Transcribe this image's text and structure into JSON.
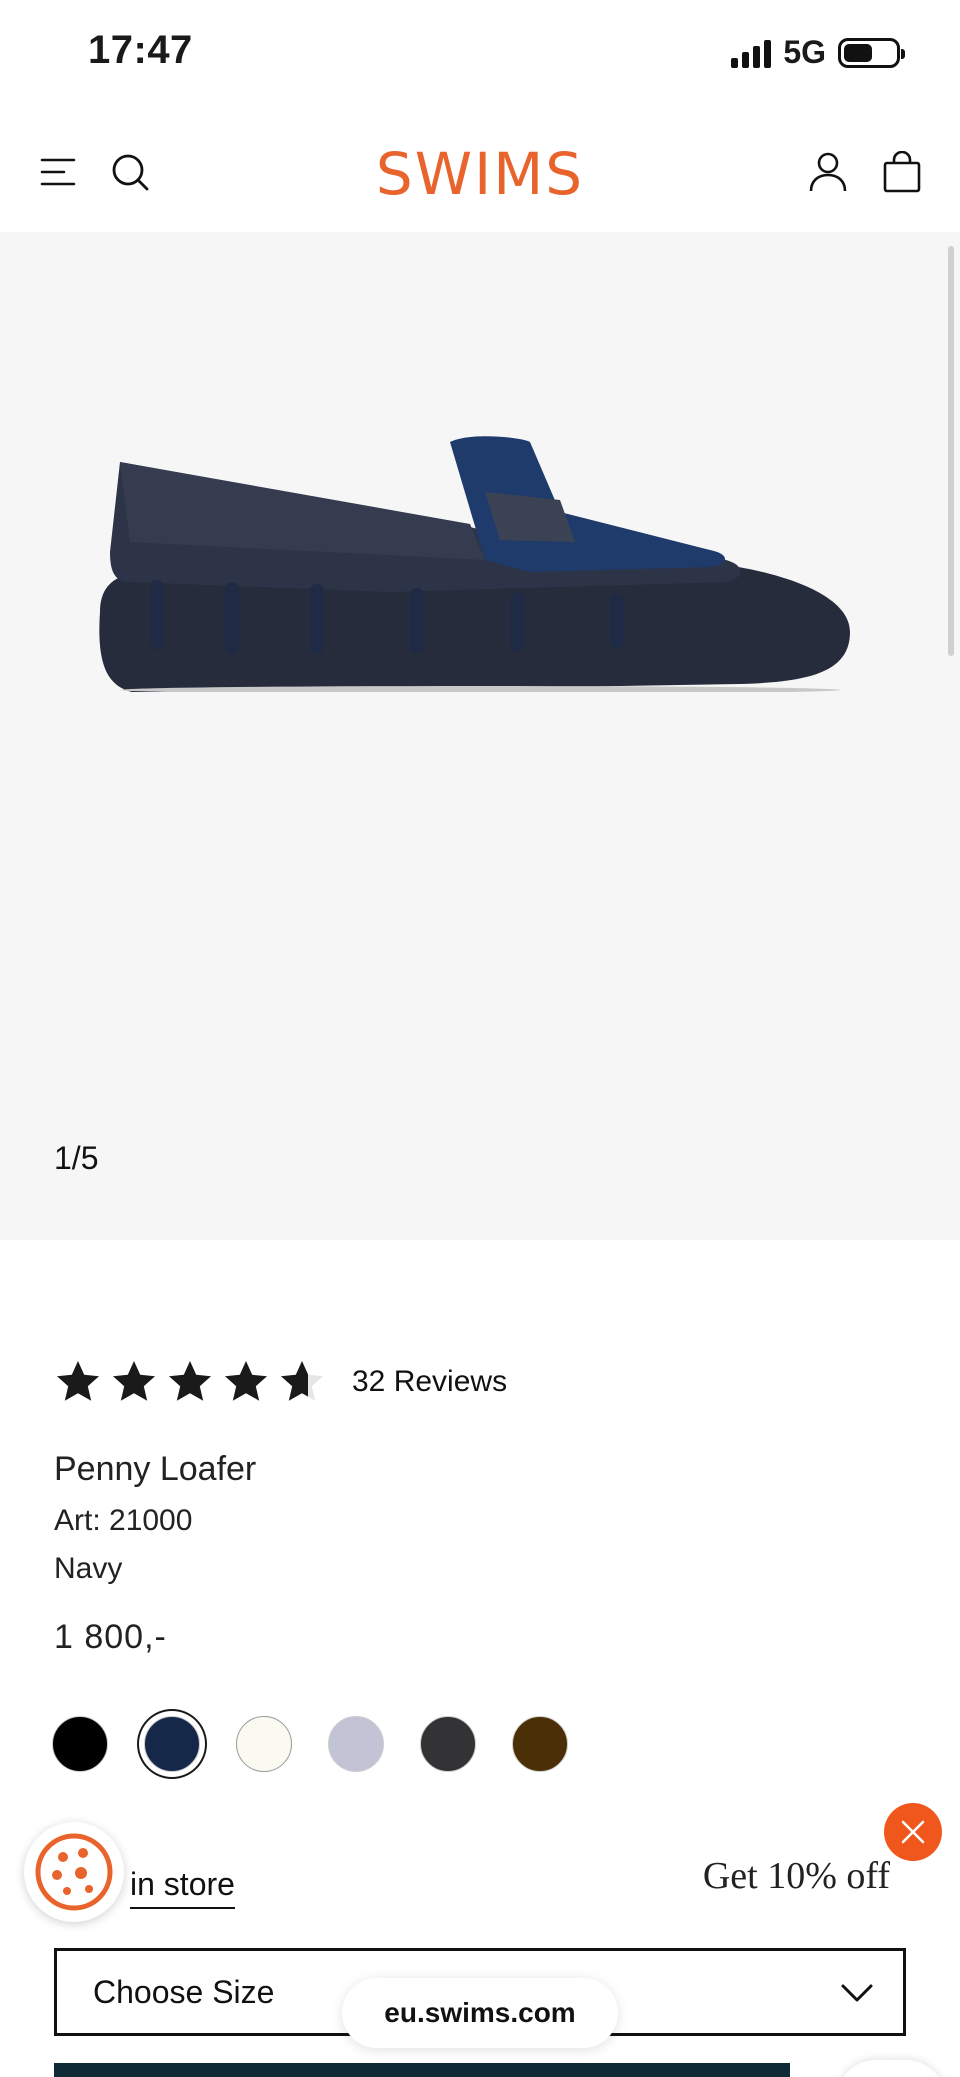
{
  "status_bar": {
    "time": "17:47",
    "network": "5G"
  },
  "header": {
    "logo": "SWIMS"
  },
  "gallery": {
    "counter": "1/5"
  },
  "product": {
    "rating_stars": 4.5,
    "reviews_label": "32 Reviews",
    "name": "Penny Loafer",
    "art": "Art: 21000",
    "color": "Navy",
    "price": "1 800,-"
  },
  "swatches": [
    {
      "color": "#000000",
      "selected": false
    },
    {
      "color": "#16284a",
      "selected": true
    },
    {
      "color": "#fbfaf1",
      "selected": false
    },
    {
      "color": "#c2c4d6",
      "selected": false
    },
    {
      "color": "#333336",
      "selected": false
    },
    {
      "color": "#4a2f07",
      "selected": false
    }
  ],
  "store_link": "in store",
  "promo": {
    "text": "Get 10% off"
  },
  "size_select": {
    "label": "Choose Size"
  },
  "url": "eu.swims.com",
  "colors": {
    "brand": "#e8642c",
    "promo_close": "#f0571d",
    "navy": "#1c2536"
  }
}
